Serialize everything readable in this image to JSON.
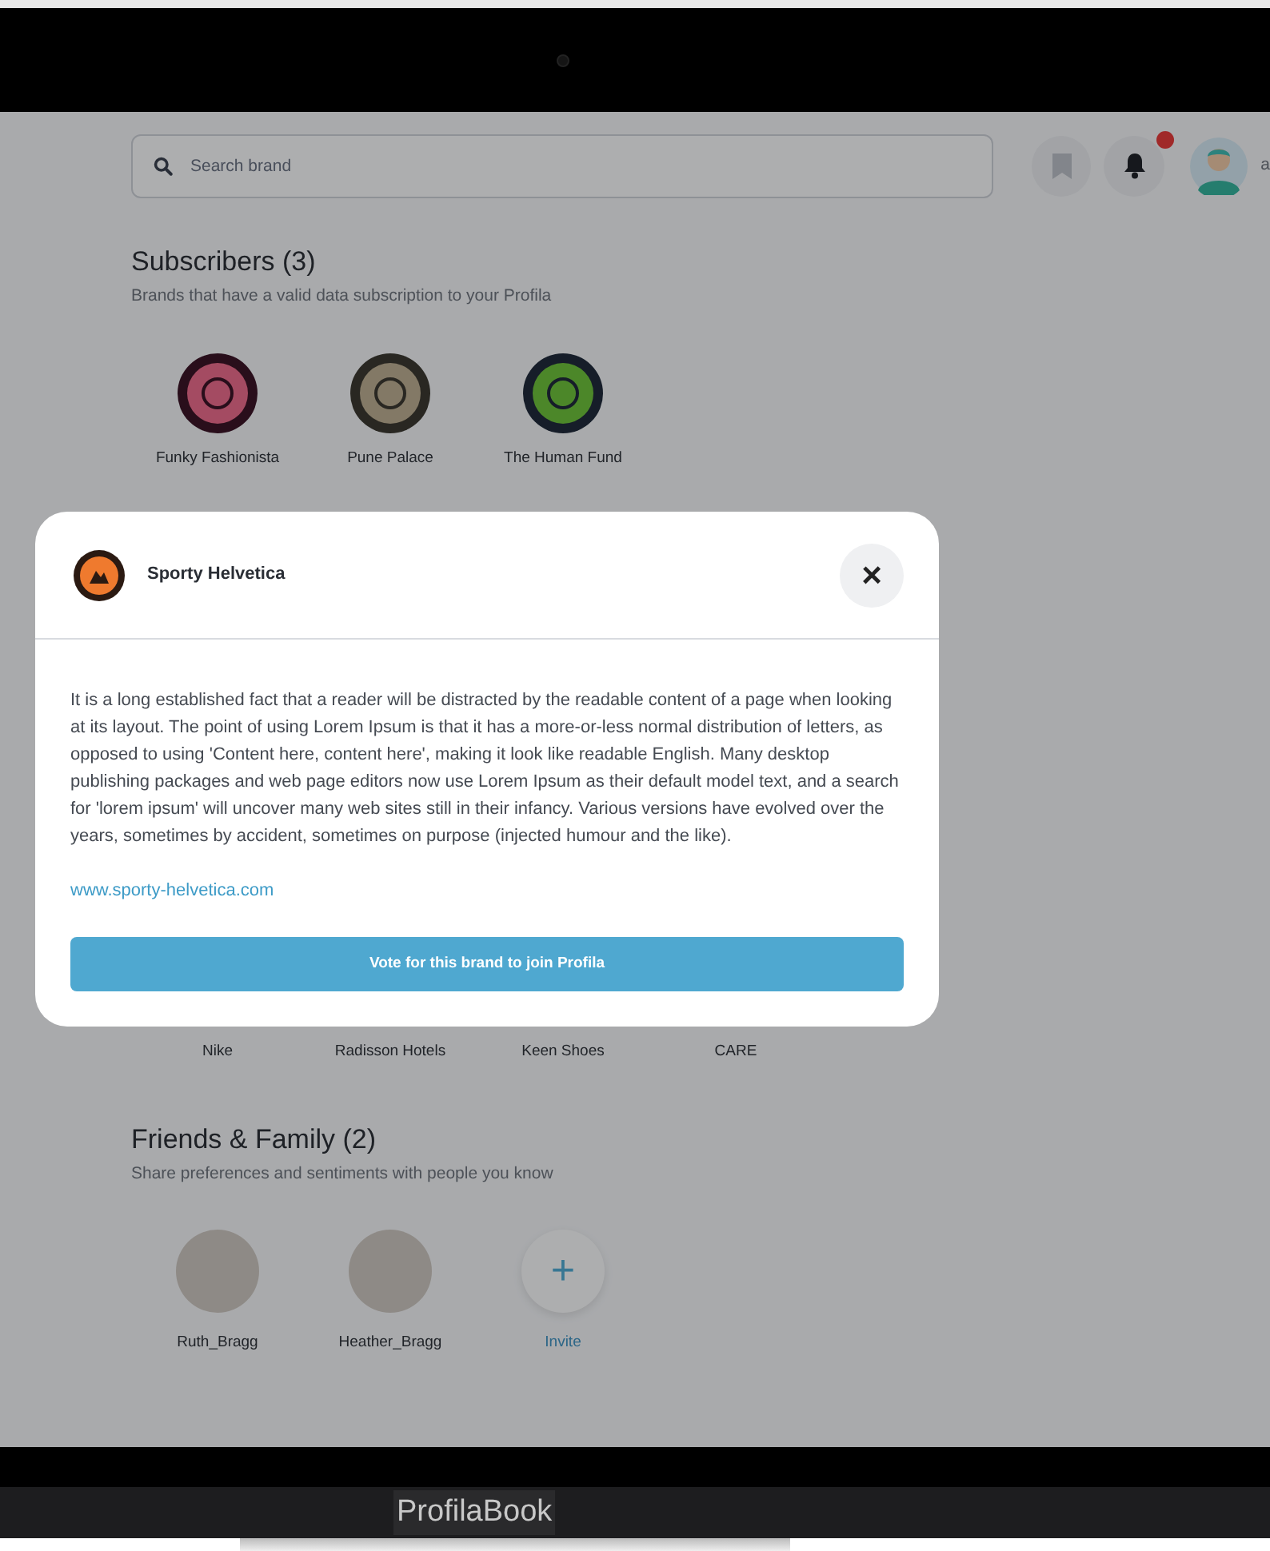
{
  "topbar": {
    "search_placeholder": "Search brand",
    "notifications_unread": true,
    "user_name": "a"
  },
  "subscribers": {
    "title": "Subscribers (3)",
    "subtitle": "Brands that have a valid data subscription to your Profila",
    "brands": [
      {
        "name": "Funky Fashionista"
      },
      {
        "name": "Pune Palace"
      },
      {
        "name": "The Human Fund"
      }
    ]
  },
  "hidden_section": {
    "brands": [
      {
        "name": "Nike"
      },
      {
        "name": "Radisson Hotels"
      },
      {
        "name": "Keen Shoes"
      },
      {
        "name": "CARE"
      }
    ]
  },
  "friends": {
    "title": "Friends & Family (2)",
    "subtitle": "Share preferences and sentiments with people you know",
    "people": [
      {
        "name": "Ruth_Bragg"
      },
      {
        "name": "Heather_Bragg"
      }
    ],
    "invite_label": "Invite",
    "invite_icon": "+"
  },
  "modal": {
    "title": "Sporty Helvetica",
    "close_icon": "×",
    "body": "It is a long established fact that a reader will be distracted by the readable content of a page when looking at its layout. The point of using Lorem Ipsum is that it has a more-or-less normal distribution of letters, as opposed to using 'Content here, content here', making it look like readable English. Many desktop publishing packages and web page editors now use Lorem Ipsum as their default model text, and a search for 'lorem ipsum' will uncover many web sites still in their infancy. Various versions have evolved over the years, sometimes by accident, sometimes on purpose (injected humour and the like).",
    "link": "www.sporty-helvetica.com",
    "button": "Vote for this brand to join Profila"
  },
  "device": {
    "label": "ProfilaBook"
  }
}
